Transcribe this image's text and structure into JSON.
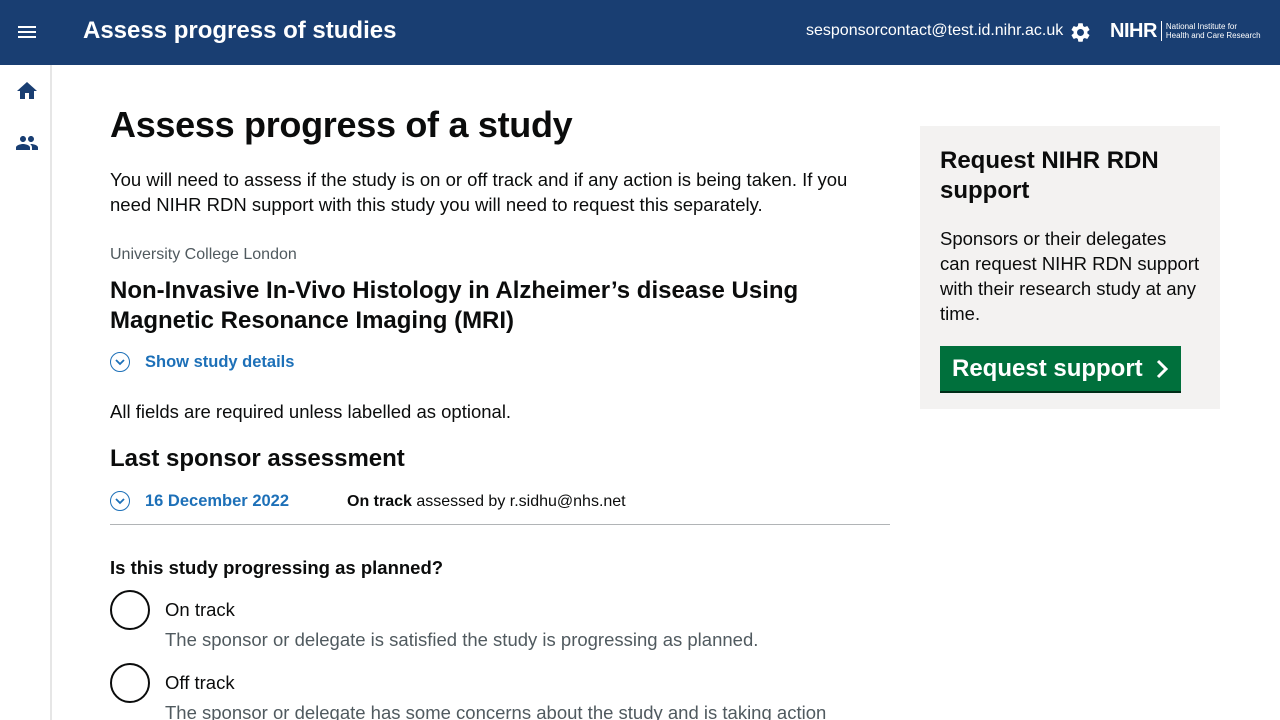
{
  "header": {
    "app_title": "Assess progress of studies",
    "user_email": "sesponsorcontact@test.id.nihr.ac.uk",
    "logo_mark": "NIHR",
    "logo_line1": "National Institute for",
    "logo_line2": "Health and Care Research",
    "background_color": "#193e72"
  },
  "sidenav": {
    "items": [
      {
        "icon": "home-icon"
      },
      {
        "icon": "people-icon"
      }
    ]
  },
  "main": {
    "title": "Assess progress of a study",
    "intro": "You will need to assess if the study is on or off track and if any action is being taken. If you need NIHR RDN support with this study you will need to request this separately.",
    "organisation": "University College London",
    "study_title": "Non-Invasive In-Vivo Histology in Alzheimer’s disease Using Magnetic Resonance Imaging (MRI)",
    "show_details_label": "Show study details",
    "required_note": "All fields are required unless labelled as optional.",
    "last_assessment": {
      "heading": "Last sponsor assessment",
      "date": "16 December 2022",
      "status": "On track",
      "assessed_by_text": "assessed by r.sidhu@nhs.net"
    },
    "question": {
      "label": "Is this study progressing as planned?",
      "options": [
        {
          "label": "On track",
          "hint": "The sponsor or delegate is satisfied the study is progressing as planned."
        },
        {
          "label": "Off track",
          "hint": "The sponsor or delegate has some concerns about the study and is taking action"
        }
      ]
    },
    "link_color": "#1d70b8"
  },
  "aside": {
    "title": "Request NIHR RDN support",
    "text": "Sponsors or their delegates can request NIHR RDN support with their research study at any time.",
    "button_label": "Request support",
    "button_color": "#00703c"
  }
}
